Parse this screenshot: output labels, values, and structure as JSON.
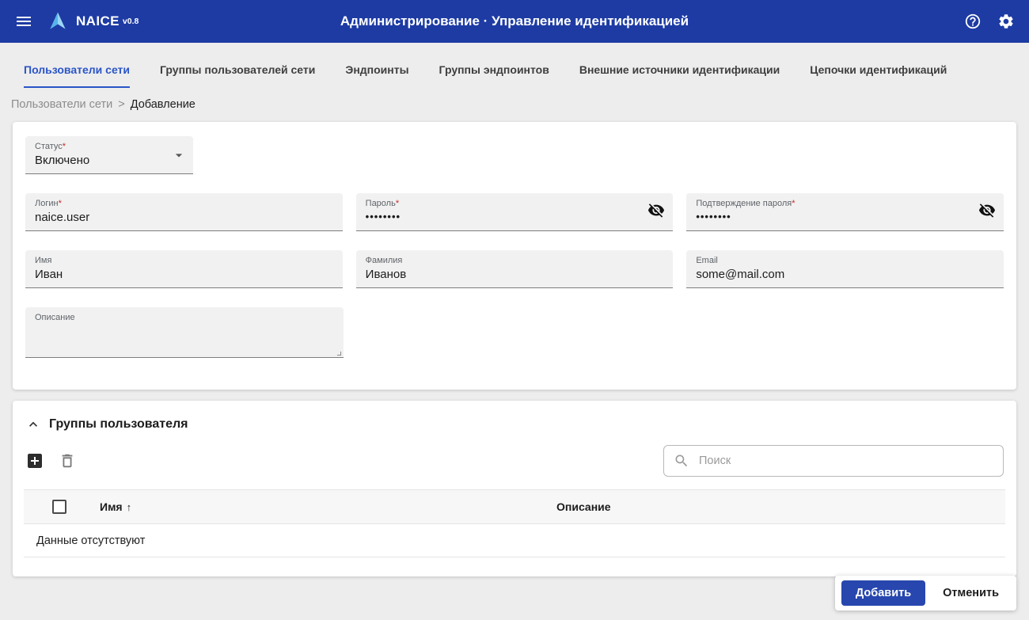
{
  "header": {
    "app_name": "NAICE",
    "app_version": "v0.8",
    "title": "Администрирование · Управление идентификацией"
  },
  "tabs": {
    "items": [
      {
        "label": "Пользователи сети",
        "active": true
      },
      {
        "label": "Группы пользователей сети",
        "active": false
      },
      {
        "label": "Эндпоинты",
        "active": false
      },
      {
        "label": "Группы эндпоинтов",
        "active": false
      },
      {
        "label": "Внешние источники идентификации",
        "active": false
      },
      {
        "label": "Цепочки идентификаций",
        "active": false
      }
    ]
  },
  "breadcrumb": {
    "parent": "Пользователи сети",
    "separator": ">",
    "current": "Добавление"
  },
  "form": {
    "status": {
      "label": "Статус",
      "required_mark": "*",
      "value": "Включено"
    },
    "login": {
      "label": "Логин",
      "required_mark": "*",
      "value": "naice.user"
    },
    "password": {
      "label": "Пароль",
      "required_mark": "*",
      "value": "••••••••"
    },
    "password_confirm": {
      "label": "Подтверждение пароля",
      "required_mark": "*",
      "value": "••••••••"
    },
    "first_name": {
      "label": "Имя",
      "value": "Иван"
    },
    "last_name": {
      "label": "Фамилия",
      "value": "Иванов"
    },
    "email": {
      "label": "Email",
      "value": "some@mail.com"
    },
    "description": {
      "label": "Описание",
      "value": ""
    }
  },
  "groups": {
    "title": "Группы пользователя",
    "search_placeholder": "Поиск",
    "columns": {
      "name": "Имя",
      "name_sort": "↑",
      "description": "Описание"
    },
    "empty_text": "Данные отсутствуют"
  },
  "footer": {
    "submit": "Добавить",
    "cancel": "Отменить"
  },
  "colors": {
    "header_bg": "#1d3ba3",
    "accent": "#2b55c8",
    "primary_button": "#2746ae",
    "required": "#c62828"
  }
}
